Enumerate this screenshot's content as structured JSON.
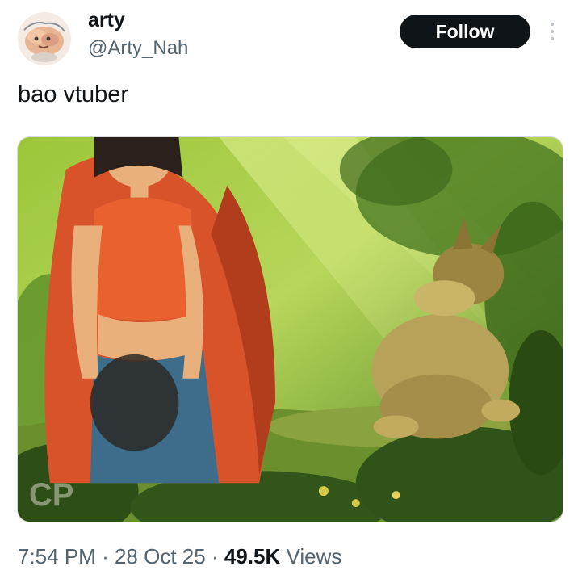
{
  "author": {
    "display_name": "arty",
    "handle": "@Arty_Nah"
  },
  "follow_label": "Follow",
  "tweet": {
    "text": "bao vtuber"
  },
  "media": {
    "watermark": "CP"
  },
  "meta": {
    "time": "7:54 PM",
    "separator": "·",
    "date": "28 Oct 25",
    "views_count": "49.5K",
    "views_label": "Views"
  },
  "colors": {
    "primary_text": "#0f1419",
    "secondary_text": "#536471",
    "button_bg": "#0f1419",
    "button_text": "#ffffff"
  },
  "icons": {
    "more": "more-dots-icon",
    "avatar": "avatar-image"
  }
}
